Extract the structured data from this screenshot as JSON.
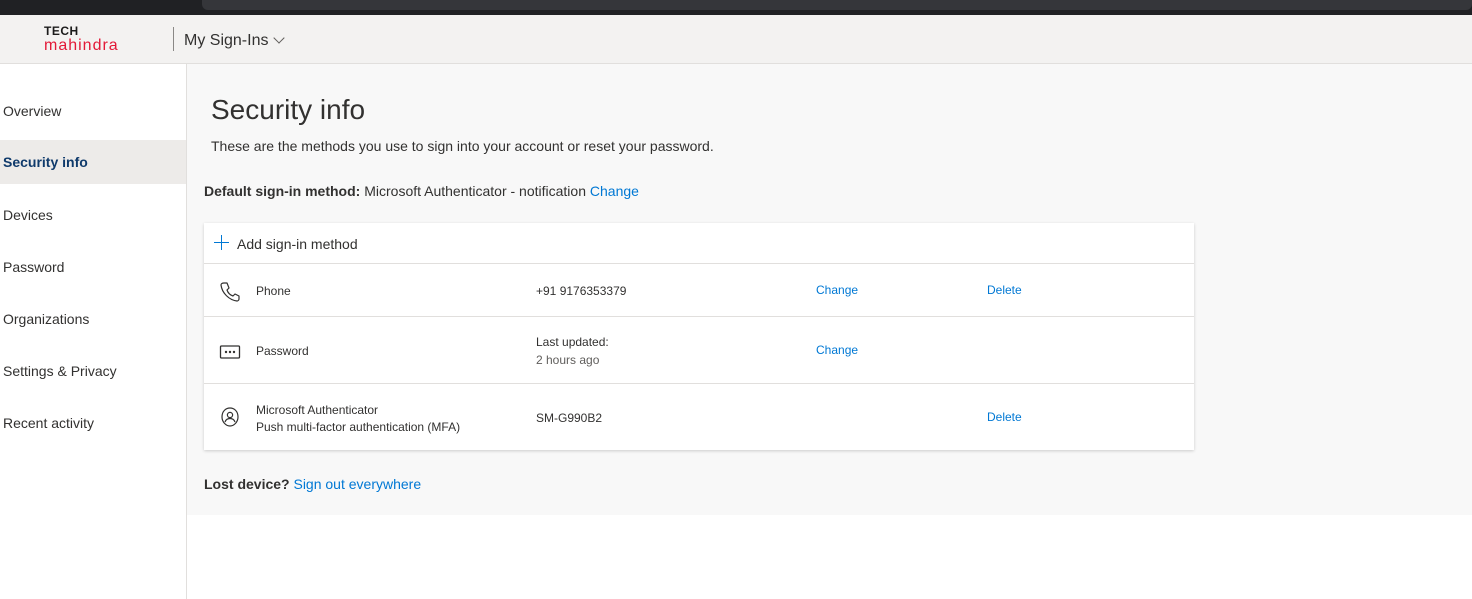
{
  "header": {
    "logo_top": "TECH",
    "logo_bottom": "mahindra",
    "app_title": "My Sign-Ins"
  },
  "sidebar": {
    "items": [
      {
        "label": "Overview"
      },
      {
        "label": "Security info"
      },
      {
        "label": "Devices"
      },
      {
        "label": "Password"
      },
      {
        "label": "Organizations"
      },
      {
        "label": "Settings & Privacy"
      },
      {
        "label": "Recent activity"
      }
    ],
    "active": "Security info"
  },
  "main": {
    "title": "Security info",
    "description": "These are the methods you use to sign into your account or reset your password.",
    "default_label": "Default sign-in method:",
    "default_value": "Microsoft Authenticator - notification",
    "default_change": "Change",
    "add_method": "Add sign-in method",
    "methods": [
      {
        "icon": "phone-icon",
        "name": "Phone",
        "detail": "+91 9176353379",
        "change": "Change",
        "delete": "Delete"
      },
      {
        "icon": "password-icon",
        "name": "Password",
        "detail": "Last updated:",
        "detail_sub": "2 hours ago",
        "change": "Change"
      },
      {
        "icon": "authenticator-icon",
        "name": "Microsoft Authenticator",
        "name_sub": "Push multi-factor authentication (MFA)",
        "detail": "SM-G990B2",
        "delete": "Delete"
      }
    ],
    "lost_label": "Lost device?",
    "lost_link": "Sign out everywhere"
  },
  "colors": {
    "accent": "#0078d4",
    "brand_red": "#e31837",
    "active_nav_bg": "#edebe9"
  }
}
